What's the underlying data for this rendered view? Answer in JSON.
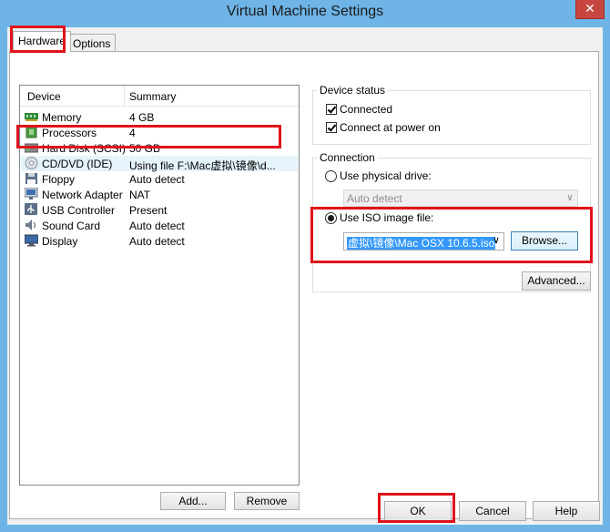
{
  "window": {
    "title": "Virtual Machine Settings",
    "close_glyph": "✕"
  },
  "tabs": [
    {
      "label": "Hardware",
      "active": true
    },
    {
      "label": "Options",
      "active": false
    }
  ],
  "device_list": {
    "col_device": "Device",
    "col_summary": "Summary",
    "rows": [
      {
        "device": "Memory",
        "summary": "4 GB",
        "icon": "memory-icon"
      },
      {
        "device": "Processors",
        "summary": "4",
        "icon": "processor-icon"
      },
      {
        "device": "Hard Disk (SCSI)",
        "summary": "50 GB",
        "icon": "hard-disk-icon"
      },
      {
        "device": "CD/DVD (IDE)",
        "summary": "Using file F:\\Mac虚拟\\镜像\\d...",
        "icon": "cd-dvd-icon",
        "selected": true
      },
      {
        "device": "Floppy",
        "summary": "Auto detect",
        "icon": "floppy-icon"
      },
      {
        "device": "Network Adapter",
        "summary": "NAT",
        "icon": "network-adapter-icon"
      },
      {
        "device": "USB Controller",
        "summary": "Present",
        "icon": "usb-icon"
      },
      {
        "device": "Sound Card",
        "summary": "Auto detect",
        "icon": "sound-card-icon"
      },
      {
        "device": "Display",
        "summary": "Auto detect",
        "icon": "display-icon"
      }
    ]
  },
  "list_buttons": {
    "add": "Add...",
    "remove": "Remove"
  },
  "device_status": {
    "title": "Device status",
    "connected": {
      "label": "Connected",
      "checked": true
    },
    "connect_at_power_on": {
      "label": "Connect at power on",
      "checked": true
    }
  },
  "connection": {
    "title": "Connection",
    "physical_drive": {
      "label": "Use physical drive:",
      "selected": false,
      "value": "Auto detect"
    },
    "iso_image": {
      "label": "Use ISO image file:",
      "selected": true,
      "value": "虚拟\\镜像\\Mac OSX 10.6.5.iso",
      "browse": "Browse..."
    },
    "advanced": "Advanced..."
  },
  "footer": {
    "ok": "OK",
    "cancel": "Cancel",
    "help": "Help"
  },
  "colors": {
    "highlight_box": "#e0121b",
    "selection": "#3399ff",
    "title_bar": "#6eb4e6"
  }
}
